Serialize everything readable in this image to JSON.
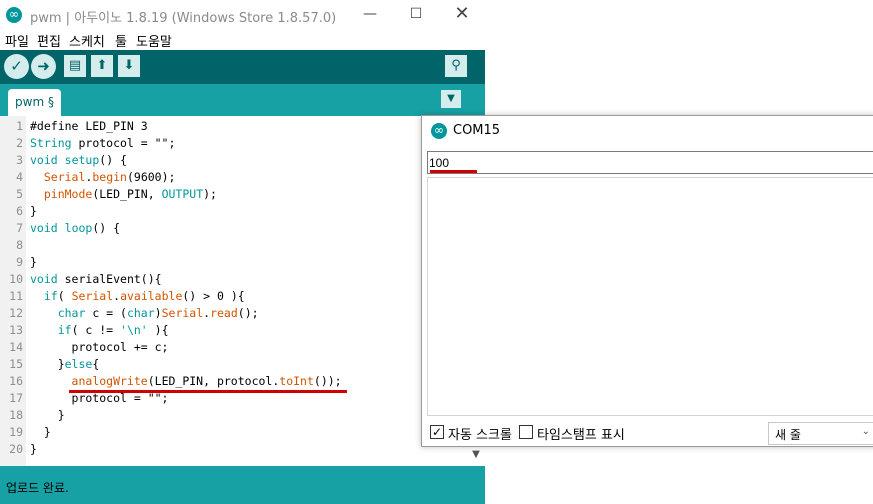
{
  "ide": {
    "title": "pwm | 아두이노 1.8.19 (Windows Store 1.8.57.0)",
    "window_buttons": {
      "minimize": "—",
      "maximize": "☐",
      "close": "✕"
    },
    "menu": [
      "파일",
      "편집",
      "스케치",
      "툴",
      "도움말"
    ],
    "toolbar": {
      "verify_icon": "✓",
      "upload_icon": "➜",
      "new_icon": "▤",
      "open_icon": "⬆",
      "save_icon": "⬇",
      "serial_monitor_icon": "⚲"
    },
    "tab": {
      "label": "pwm §",
      "menu_icon": "▼"
    },
    "line_numbers": [
      "1",
      "2",
      "3",
      "4",
      "5",
      "6",
      "7",
      "8",
      "9",
      "10",
      "11",
      "12",
      "13",
      "14",
      "15",
      "16",
      "17",
      "18",
      "19",
      "20"
    ],
    "status": "업로드 완료.",
    "scroll_down_icon": "▼"
  },
  "serial_monitor": {
    "title": "COM15",
    "input_value": "100",
    "autoscroll_label": "자동 스크롤",
    "autoscroll_checked": "✓",
    "timestamp_label": "타임스탬프 표시",
    "line_ending": "새 줄",
    "dropdown_icon": "⌄"
  },
  "colors": {
    "toolbar": "#006468",
    "tabbar": "#17a1a5",
    "keyword": "#00979c",
    "function": "#d35400",
    "highlight_underline": "#d00000"
  }
}
